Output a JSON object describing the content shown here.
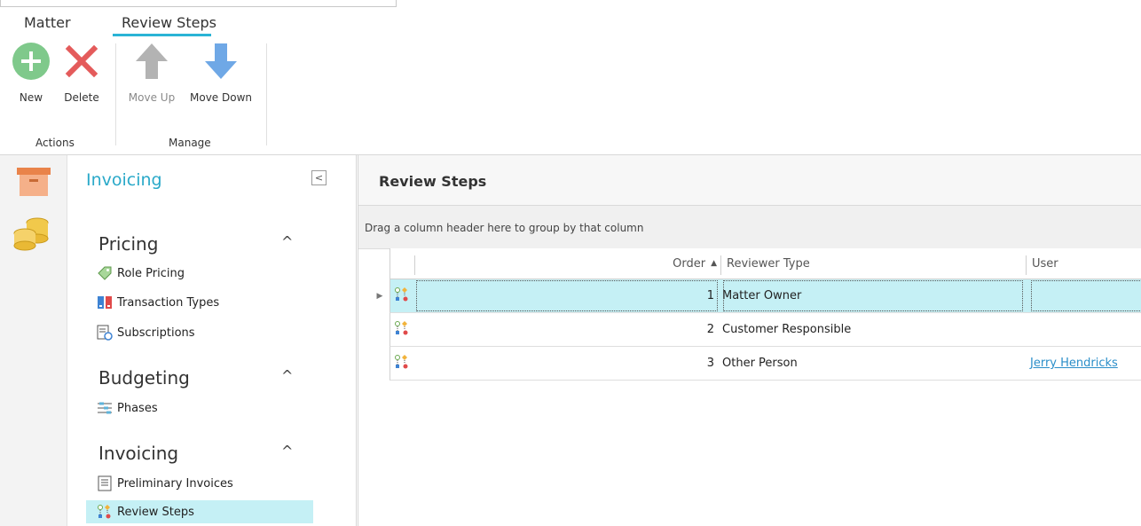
{
  "ribbon": {
    "tabs": [
      {
        "label": "Matter"
      },
      {
        "label": "Review Steps"
      }
    ],
    "groups": [
      {
        "label": "Actions"
      },
      {
        "label": "Manage"
      }
    ],
    "buttons": {
      "new": "New",
      "delete": "Delete",
      "move_up": "Move Up",
      "move_down": "Move Down"
    }
  },
  "nav": {
    "title": "Invoicing",
    "sections": [
      {
        "label": "Pricing",
        "items": [
          {
            "label": "Role Pricing",
            "icon": "tag-icon"
          },
          {
            "label": "Transaction Types",
            "icon": "transaction-types-icon"
          },
          {
            "label": "Subscriptions",
            "icon": "subscriptions-icon"
          }
        ]
      },
      {
        "label": "Budgeting",
        "items": [
          {
            "label": "Phases",
            "icon": "phases-icon"
          }
        ]
      },
      {
        "label": "Invoicing",
        "items": [
          {
            "label": "Preliminary Invoices",
            "icon": "document-icon"
          },
          {
            "label": "Review Steps",
            "icon": "review-steps-icon"
          }
        ]
      }
    ]
  },
  "main": {
    "title": "Review Steps",
    "group_hint": "Drag a column header here to group by that column",
    "columns": [
      "Order",
      "Reviewer Type",
      "User"
    ],
    "rows": [
      {
        "order": "1",
        "reviewer_type": "Matter Owner",
        "user": ""
      },
      {
        "order": "2",
        "reviewer_type": "Customer Responsible",
        "user": ""
      },
      {
        "order": "3",
        "reviewer_type": "Other Person",
        "user": "Jerry Hendricks"
      }
    ]
  },
  "colors": {
    "accent": "#2ab4d6",
    "selection": "#c5f0f5",
    "link": "#2a8ec9"
  }
}
